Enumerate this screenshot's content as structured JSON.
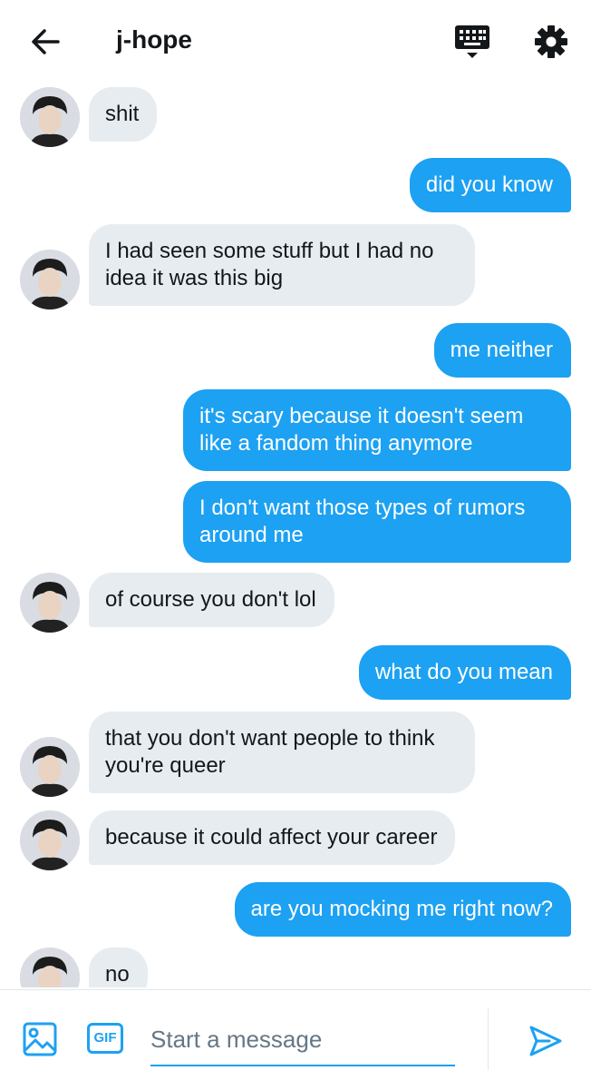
{
  "header": {
    "back_icon": "arrow-left-icon",
    "title": "j-hope",
    "keyboard_icon": "keyboard-icon",
    "settings_icon": "gear-icon"
  },
  "colors": {
    "accent": "#1da1f2",
    "incoming_bubble": "#e6ecf0",
    "text": "#14171a",
    "placeholder": "#657786"
  },
  "messages": [
    {
      "from": "them",
      "text": "shit"
    },
    {
      "from": "me",
      "text": "did you know"
    },
    {
      "from": "them",
      "text": "I had seen some stuff but I had no idea it was this big"
    },
    {
      "from": "me",
      "text": "me neither"
    },
    {
      "from": "me",
      "text": "it's scary because it doesn't seem like a fandom thing anymore"
    },
    {
      "from": "me",
      "text": "I don't want those types of rumors around me"
    },
    {
      "from": "them",
      "text": "of course you don't lol"
    },
    {
      "from": "me",
      "text": "what do you mean"
    },
    {
      "from": "them",
      "text": "that you don't want people to think you're queer"
    },
    {
      "from": "them",
      "text": "because it could affect your career"
    },
    {
      "from": "me",
      "text": "are you mocking me right now?"
    },
    {
      "from": "them",
      "text": "no"
    }
  ],
  "composer": {
    "image_icon": "image-icon",
    "gif_label": "GIF",
    "placeholder": "Start a message",
    "value": "",
    "send_icon": "send-icon"
  }
}
